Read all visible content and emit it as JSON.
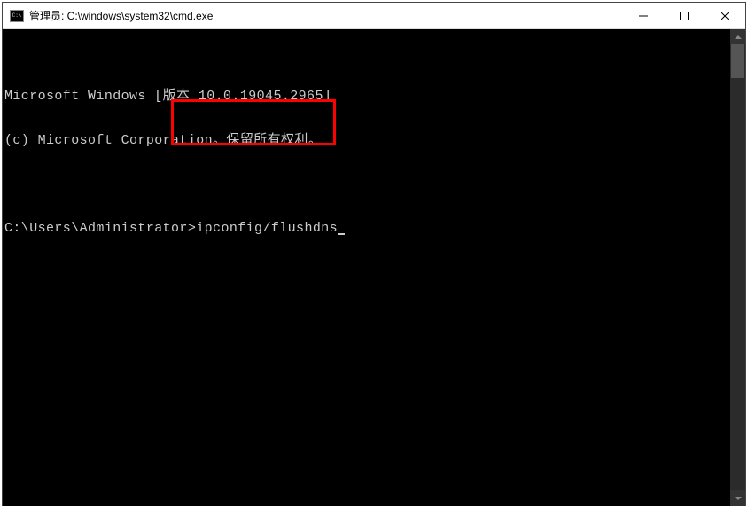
{
  "title": "管理员: C:\\windows\\system32\\cmd.exe",
  "terminal": {
    "line1": "Microsoft Windows [版本 10.0.19045.2965]",
    "line2": "(c) Microsoft Corporation。保留所有权利。",
    "prompt": "C:\\Users\\Administrator>",
    "command": "ipconfig/flushdns"
  },
  "controls": {
    "min": "—",
    "max": "☐",
    "close": "✕"
  },
  "icon_label": "C:\\"
}
